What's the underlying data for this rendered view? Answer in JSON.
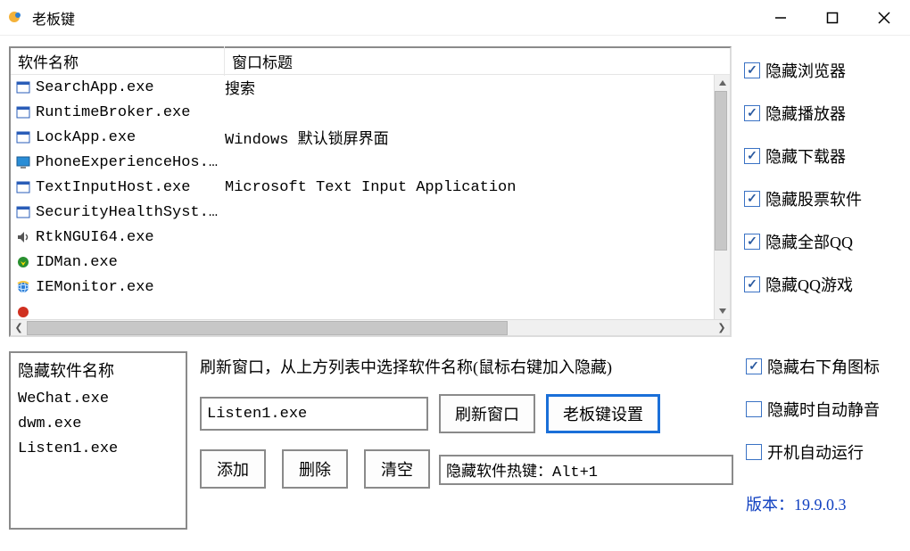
{
  "window": {
    "title": "老板键"
  },
  "columns": {
    "name": "软件名称",
    "title": "窗口标题"
  },
  "processes": [
    {
      "icon": "win-blue",
      "name": "SearchApp.exe",
      "title": "搜索"
    },
    {
      "icon": "win-blue",
      "name": "RuntimeBroker.exe",
      "title": ""
    },
    {
      "icon": "win-blue",
      "name": "LockApp.exe",
      "title": "Windows 默认锁屏界面"
    },
    {
      "icon": "monitor",
      "name": "PhoneExperienceHos...",
      "title": ""
    },
    {
      "icon": "win-blue",
      "name": "TextInputHost.exe",
      "title": "Microsoft Text Input Application"
    },
    {
      "icon": "win-blue",
      "name": "SecurityHealthSyst...",
      "title": ""
    },
    {
      "icon": "speaker",
      "name": "RtkNGUI64.exe",
      "title": ""
    },
    {
      "icon": "dl-green",
      "name": "IDMan.exe",
      "title": ""
    },
    {
      "icon": "globe",
      "name": "IEMonitor.exe",
      "title": ""
    },
    {
      "icon": "red-dot",
      "name": "",
      "title": ""
    }
  ],
  "right_checks": [
    {
      "label": "隐藏浏览器",
      "checked": true
    },
    {
      "label": "隐藏播放器",
      "checked": true
    },
    {
      "label": "隐藏下载器",
      "checked": true
    },
    {
      "label": "隐藏股票软件",
      "checked": true
    },
    {
      "label": "隐藏全部QQ",
      "checked": true
    },
    {
      "label": "隐藏QQ游戏",
      "checked": true
    }
  ],
  "hidden_list": {
    "header": "隐藏软件名称",
    "items": [
      "WeChat.exe",
      "dwm.exe",
      "Listen1.exe"
    ]
  },
  "mid": {
    "hint": "刷新窗口，从上方列表中选择软件名称(鼠标右键加入隐藏)",
    "input_value": "Listen1.exe",
    "btn_refresh": "刷新窗口",
    "btn_settings": "老板键设置",
    "btn_add": "添加",
    "btn_del": "删除",
    "btn_clear": "清空"
  },
  "hotkeys": {
    "line1": "隐藏软件热键：Alt+1"
  },
  "right_bottom_checks": [
    {
      "label": "隐藏右下角图标",
      "checked": true
    },
    {
      "label": "隐藏时自动静音",
      "checked": false
    },
    {
      "label": "开机自动运行",
      "checked": false
    }
  ],
  "version_label": "版本：19.9.0.3"
}
